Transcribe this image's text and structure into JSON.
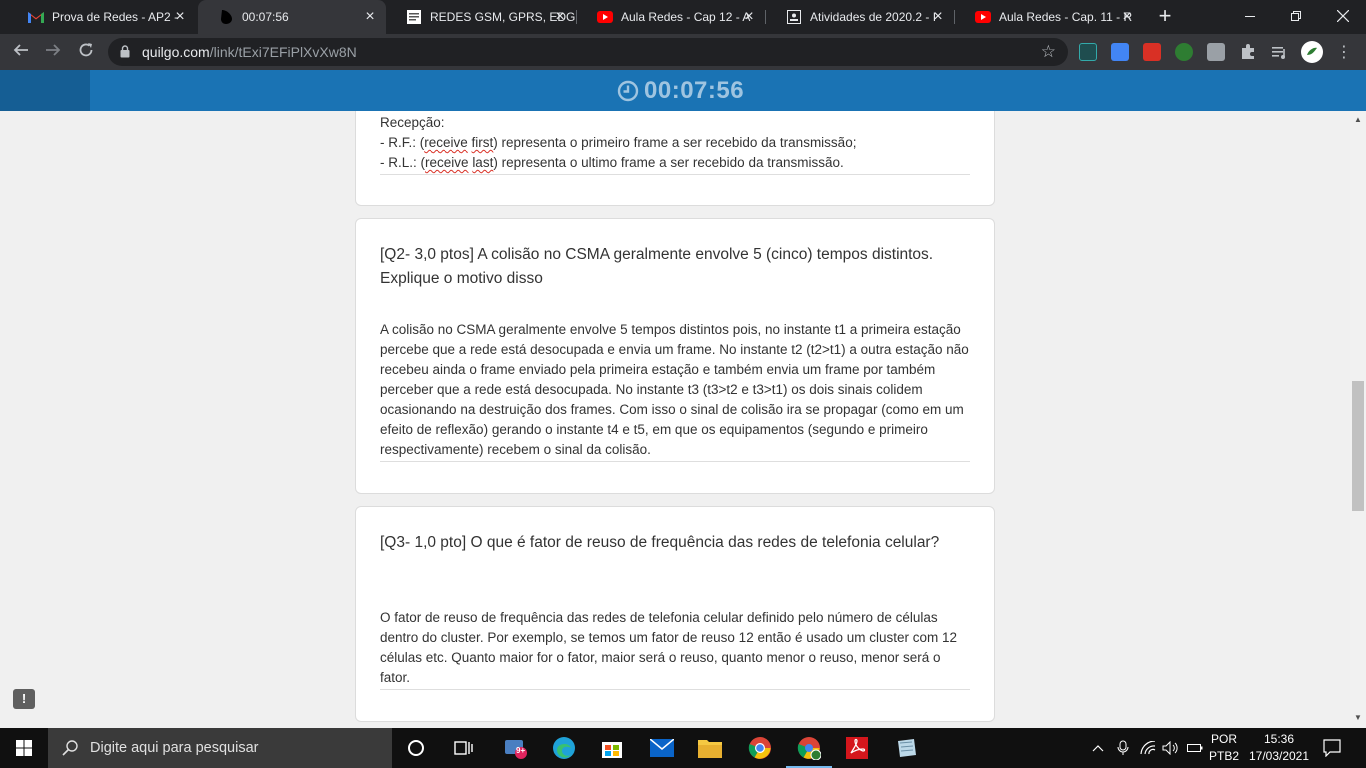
{
  "browser": {
    "tabs": [
      {
        "title": "Prova de Redes - AP2 -",
        "favicon": "gmail-icon",
        "active": false
      },
      {
        "title": "00:07:56",
        "favicon": "quilgo-icon",
        "active": true
      },
      {
        "title": "REDES GSM, GPRS, EDG",
        "favicon": "document-icon",
        "active": false
      },
      {
        "title": "Aula Redes - Cap 12 - A",
        "favicon": "youtube-icon",
        "active": false
      },
      {
        "title": "Atividades de 2020.2 - I",
        "favicon": "classroom-icon",
        "active": false
      },
      {
        "title": "Aula Redes - Cap. 11 - R",
        "favicon": "youtube-icon",
        "active": false
      }
    ],
    "url_domain": "quilgo.com",
    "url_path": "/link/tExi7EFiPlXvXw8N"
  },
  "page": {
    "timer": "00:07:56",
    "q1": {
      "lines": [
        "Recepção:",
        "- R.F.: (receive first) representa o primeiro frame a ser recebido da transmissão;",
        "- R.L.: (receive last) representa o ultimo frame a ser recebido da transmissão."
      ],
      "l2_a": "- R.F.: (",
      "l2_b": "receive",
      "l2_c": " ",
      "l2_d": "first",
      "l2_e": ") representa o primeiro frame a ser recebido da transmissão;",
      "l3_a": "- R.L.: (",
      "l3_b": "receive",
      "l3_c": " ",
      "l3_d": "last",
      "l3_e": ") representa o ultimo frame a ser recebido da transmissão."
    },
    "q2": {
      "question": "[Q2- 3,0 ptos] A colisão no CSMA geralmente envolve 5 (cinco) tempos distintos. Explique o motivo disso",
      "answer": "A colisão no CSMA geralmente envolve 5 tempos distintos pois, no instante t1 a primeira estação percebe que a rede está desocupada e envia um frame. No instante t2 (t2>t1) a outra estação não recebeu ainda o frame enviado pela primeira estação e também envia um frame por também perceber que a rede está desocupada. No instante t3 (t3>t2 e t3>t1) os dois sinais colidem ocasionando na destruição dos frames. Com isso o sinal de colisão ira se propagar (como em um efeito de reflexão) gerando o instante t4 e t5, em que os equipamentos (segundo e primeiro respectivamente) recebem o sinal da colisão."
    },
    "q3": {
      "question": "[Q3- 1,0 pto] O que é fator de reuso de frequência das redes de telefonia celular?",
      "answer": "O fator de reuso de frequência das redes de telefonia celular definido pelo número de células dentro do cluster. Por exemplo, se temos um fator de reuso 12 então é usado um cluster com 12 células etc. Quanto maior for o fator, maior será o reuso, quanto menor o reuso, menor será o fator."
    }
  },
  "taskbar": {
    "search_placeholder": "Digite aqui para pesquisar",
    "mail_badge": "9+",
    "lang_line1": "POR",
    "lang_line2": "PTB2",
    "time": "15:36",
    "date": "17/03/2021"
  },
  "colors": {
    "timer_bar": "#1a73b4",
    "timer_text": "#9fc4e0",
    "chrome_dark": "#202124",
    "chrome_toolbar": "#35363a"
  }
}
